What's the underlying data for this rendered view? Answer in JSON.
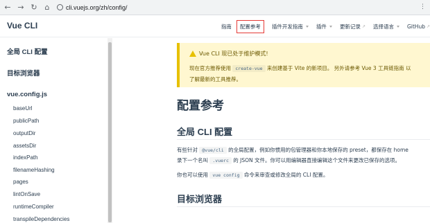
{
  "browser": {
    "url": "cli.vuejs.org/zh/config/"
  },
  "header": {
    "site_name": "Vue CLI",
    "nav": [
      {
        "label": "指南",
        "caret": false,
        "ext": false,
        "active": false
      },
      {
        "label": "配置参考",
        "caret": false,
        "ext": false,
        "active": true
      },
      {
        "label": "插件开发指南",
        "caret": true,
        "ext": false,
        "active": false
      },
      {
        "label": "插件",
        "caret": true,
        "ext": false,
        "active": false
      },
      {
        "label": "更新记录",
        "caret": false,
        "ext": true,
        "active": false
      },
      {
        "label": "选择语言",
        "caret": true,
        "ext": false,
        "active": false
      },
      {
        "label": "GitHub",
        "caret": false,
        "ext": true,
        "active": false
      }
    ]
  },
  "sidebar": {
    "groups": [
      "全局 CLI 配置",
      "目标浏览器",
      "vue.config.js"
    ],
    "items": [
      "baseUrl",
      "publicPath",
      "outputDir",
      "assetsDir",
      "indexPath",
      "filenameHashing",
      "pages",
      "lintOnSave",
      "runtimeCompiler",
      "transpileDependencies"
    ]
  },
  "warning": {
    "title": "Vue CLI 现已处于维护模式!",
    "line1_prefix": "现在官方推荐使用",
    "line1_code": "create-vue",
    "line1_suffix": "来创建基于 Vite 的新项目。 另外请参考 Vue 3 工具链指南 以",
    "line2": "了解最新的工具推荐。"
  },
  "main": {
    "title": "配置参考",
    "section1_title": "全局 CLI 配置",
    "p1_a": "有些针对",
    "p1_code1": "@vue/cli",
    "p1_b": "的全局配置，例如你惯用的包管理器和你本地保存的 preset，都保存在 home",
    "p1_c": "录下一个名叫",
    "p1_code2": ".vuerc",
    "p1_d": "的 JSON 文件。你可以用编辑器直接编辑这个文件来更改已保存的选项。",
    "p2_a": "你也可以使用",
    "p2_code": "vue config",
    "p2_b": "命令来审查或修改全局的 CLI 配置。",
    "section2_title": "目标浏览器"
  }
}
